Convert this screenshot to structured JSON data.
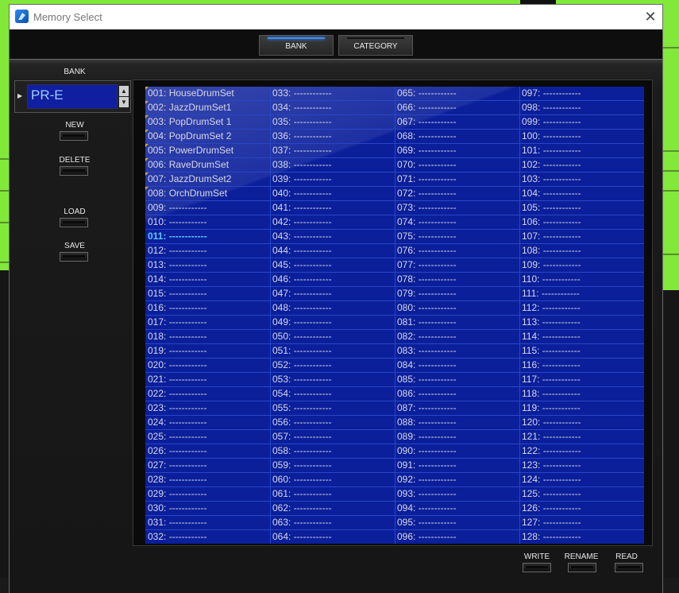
{
  "window": {
    "title": "Memory Select",
    "close_glyph": "✕"
  },
  "tabs": [
    {
      "label": "BANK",
      "active": true
    },
    {
      "label": "CATEGORY",
      "active": false
    }
  ],
  "sidebar": {
    "bank_label": "BANK",
    "bank_value": "PR-E",
    "spin_up": "▲",
    "spin_down": "▼",
    "new_label": "NEW",
    "delete_label": "DELETE",
    "load_label": "LOAD",
    "save_label": "SAVE"
  },
  "footer": {
    "write_label": "WRITE",
    "rename_label": "RENAME",
    "read_label": "READ"
  },
  "list": {
    "selected_index": 10,
    "entries": [
      "001: HouseDrumSet",
      "002: JazzDrumSet1",
      "003: PopDrumSet 1",
      "004: PopDrumSet 2",
      "005: PowerDrumSet",
      "006: RaveDrumSet",
      "007: JazzDrumSet2",
      "008: OrchDrumSet",
      "009: ------------",
      "010: ------------",
      "011: ------------",
      "012: ------------",
      "013: ------------",
      "014: ------------",
      "015: ------------",
      "016: ------------",
      "017: ------------",
      "018: ------------",
      "019: ------------",
      "020: ------------",
      "021: ------------",
      "022: ------------",
      "023: ------------",
      "024: ------------",
      "025: ------------",
      "026: ------------",
      "027: ------------",
      "028: ------------",
      "029: ------------",
      "030: ------------",
      "031: ------------",
      "032: ------------",
      "033: ------------",
      "034: ------------",
      "035: ------------",
      "036: ------------",
      "037: ------------",
      "038: ------------",
      "039: ------------",
      "040: ------------",
      "041: ------------",
      "042: ------------",
      "043: ------------",
      "044: ------------",
      "045: ------------",
      "046: ------------",
      "047: ------------",
      "048: ------------",
      "049: ------------",
      "050: ------------",
      "051: ------------",
      "052: ------------",
      "053: ------------",
      "054: ------------",
      "055: ------------",
      "056: ------------",
      "057: ------------",
      "058: ------------",
      "059: ------------",
      "060: ------------",
      "061: ------------",
      "062: ------------",
      "063: ------------",
      "064: ------------",
      "065: ------------",
      "066: ------------",
      "067: ------------",
      "068: ------------",
      "069: ------------",
      "070: ------------",
      "071: ------------",
      "072: ------------",
      "073: ------------",
      "074: ------------",
      "075: ------------",
      "076: ------------",
      "077: ------------",
      "078: ------------",
      "079: ------------",
      "080: ------------",
      "081: ------------",
      "082: ------------",
      "083: ------------",
      "084: ------------",
      "085: ------------",
      "086: ------------",
      "087: ------------",
      "088: ------------",
      "089: ------------",
      "090: ------------",
      "091: ------------",
      "092: ------------",
      "093: ------------",
      "094: ------------",
      "095: ------------",
      "096: ------------",
      "097: ------------",
      "098: ------------",
      "099: ------------",
      "100: ------------",
      "101: ------------",
      "102: ------------",
      "103: ------------",
      "104: ------------",
      "105: ------------",
      "106: ------------",
      "107: ------------",
      "108: ------------",
      "109: ------------",
      "110: ------------",
      "111: ------------",
      "112: ------------",
      "113: ------------",
      "114: ------------",
      "115: ------------",
      "116: ------------",
      "117: ------------",
      "118: ------------",
      "119: ------------",
      "120: ------------",
      "121: ------------",
      "122: ------------",
      "123: ------------",
      "124: ------------",
      "125: ------------",
      "126: ------------",
      "127: ------------",
      "128: ------------"
    ],
    "marked": [
      0,
      1,
      2,
      3,
      4,
      5,
      6,
      7
    ]
  },
  "colors": {
    "list_bg": "#0b1f9a",
    "list_line": "#2846c8",
    "accent": "#3a8cff",
    "selected_text": "#5cc8ff",
    "background_app": "#82e83a"
  }
}
